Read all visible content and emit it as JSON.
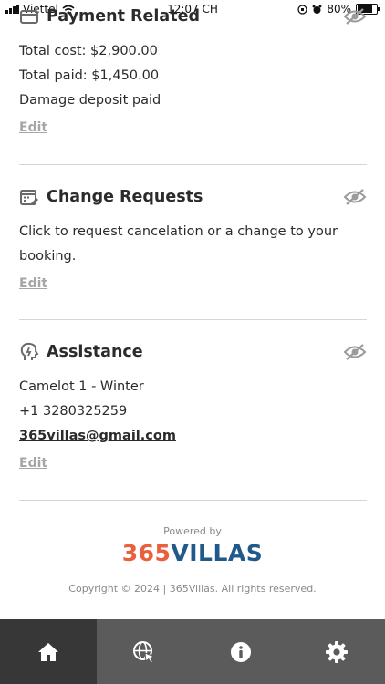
{
  "status_bar": {
    "carrier": "Viettel",
    "time": "12:07 CH",
    "battery": "80%",
    "battery_level": 0.8
  },
  "payment": {
    "title": "Payment Related",
    "lines": [
      "Total cost: $2,900.00",
      "Total paid: $1,450.00",
      "Damage deposit paid"
    ],
    "edit_label": "Edit"
  },
  "change_requests": {
    "title": "Change Requests",
    "lines": [
      "Click to request cancelation or a change to your",
      "booking."
    ],
    "edit_label": "Edit"
  },
  "assistance": {
    "title": "Assistance",
    "name": "Camelot 1 - Winter",
    "phone": "+1 3280325259",
    "email": "365villas@gmail.com",
    "edit_label": "Edit"
  },
  "footer": {
    "powered_by": "Powered by",
    "logo_num": "365",
    "logo_text": "VILLAS",
    "copyright": "Copyright © 2024 | 365Villas. All rights reserved."
  },
  "colors": {
    "accent_orange": "#e8603c",
    "accent_blue": "#1f5a8a",
    "tabbar": "#5b5b5b",
    "tab_active": "#373737"
  },
  "tabbar": {
    "tabs": [
      {
        "icon": "home-icon",
        "active": true
      },
      {
        "icon": "globe-cursor-icon",
        "active": false
      },
      {
        "icon": "info-icon",
        "active": false
      },
      {
        "icon": "gear-icon",
        "active": false
      }
    ]
  }
}
